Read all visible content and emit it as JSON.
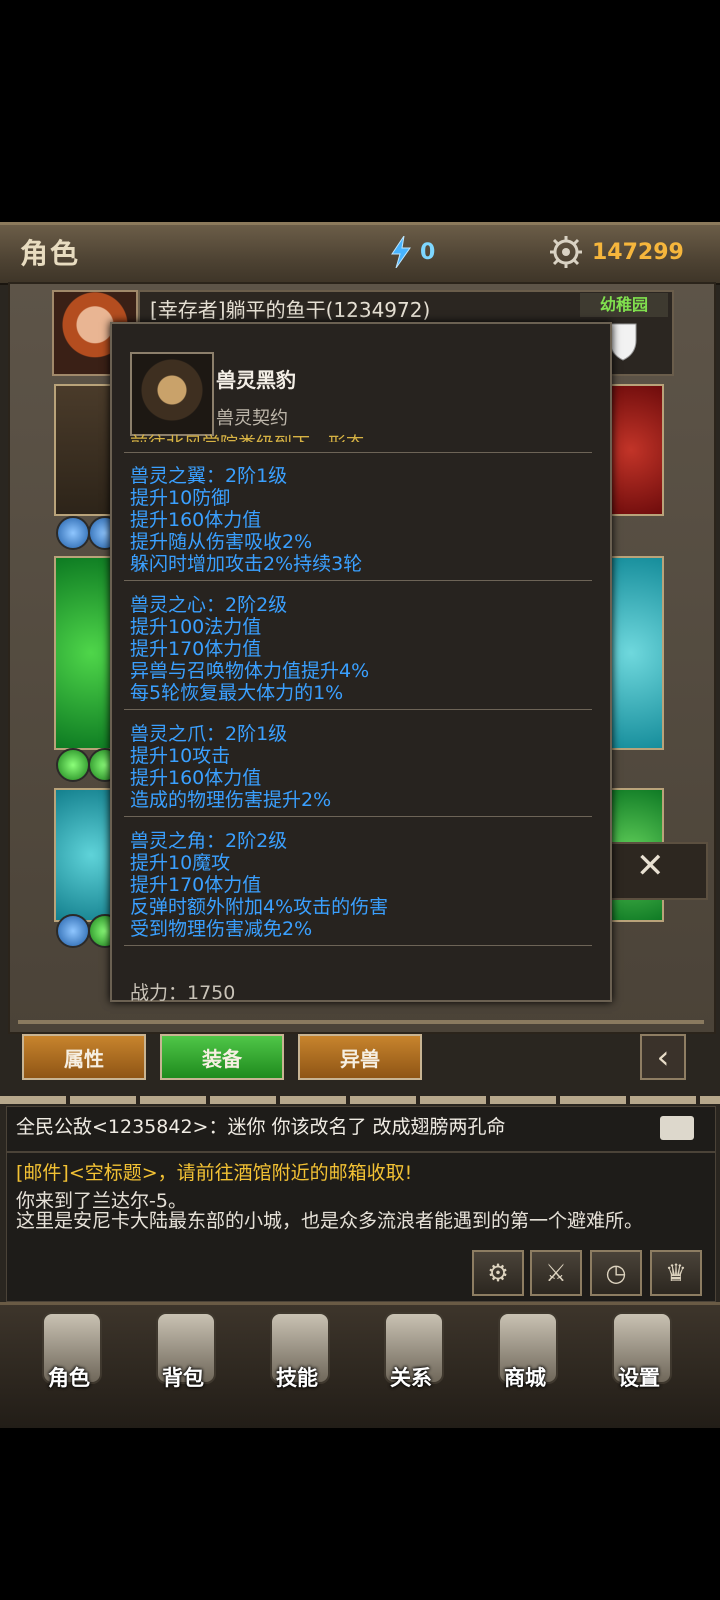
{
  "header": {
    "title": "角色",
    "energy": "0",
    "gold": "147299",
    "colors": {
      "energy": "#7ed7ff",
      "gold": "#f6b63c"
    }
  },
  "player": {
    "name": "[幸存者]躺平的鱼干(1234972)",
    "guild": "幼稚园"
  },
  "popup": {
    "item_name": "兽灵黑豹",
    "item_type": "兽灵契约",
    "clipped_text": "前往北风学院类级到下一形态",
    "sections": [
      {
        "lines": [
          "兽灵之翼：2阶1级",
          "提升10防御",
          "提升160体力值",
          "提升随从伤害吸收2%",
          "躲闪时增加攻击2%持续3轮"
        ]
      },
      {
        "lines": [
          "兽灵之心：2阶2级",
          "提升100法力值",
          "提升170体力值",
          "异兽与召唤物体力值提升4%",
          "每5轮恢复最大体力的1%"
        ]
      },
      {
        "lines": [
          "兽灵之爪：2阶1级",
          "提升10攻击",
          "提升160体力值",
          "造成的物理伤害提升2%"
        ]
      },
      {
        "lines": [
          "兽灵之角：2阶2级",
          "提升10魔攻",
          "提升170体力值",
          "反弹时额外附加4%攻击的伤害",
          "受到物理伤害减免2%"
        ]
      }
    ],
    "combat_power": "战力：1750",
    "colors": {
      "stat_text": "#3aa0ff"
    }
  },
  "tabs": [
    "属性",
    "装备",
    "异兽"
  ],
  "chat": {
    "world_line": "全民公敌<1235842>：迷你  你该改名了 改成翅膀两孔命",
    "mail_line": "[邮件]<空标题>，请前往酒馆附近的邮箱收取!",
    "log_1": "你来到了兰达尔-5。",
    "log_2": "这里是安尼卡大陆最东部的小城，也是众多流浪者能遇到的第一个避难所。"
  },
  "bottom_nav": [
    "角色",
    "背包",
    "技能",
    "关系",
    "商城",
    "设置"
  ],
  "icons": {
    "energy": "lightning-icon",
    "gold": "gear-coin-icon",
    "close": "close-icon",
    "collapse": "chevron-left-icon"
  }
}
